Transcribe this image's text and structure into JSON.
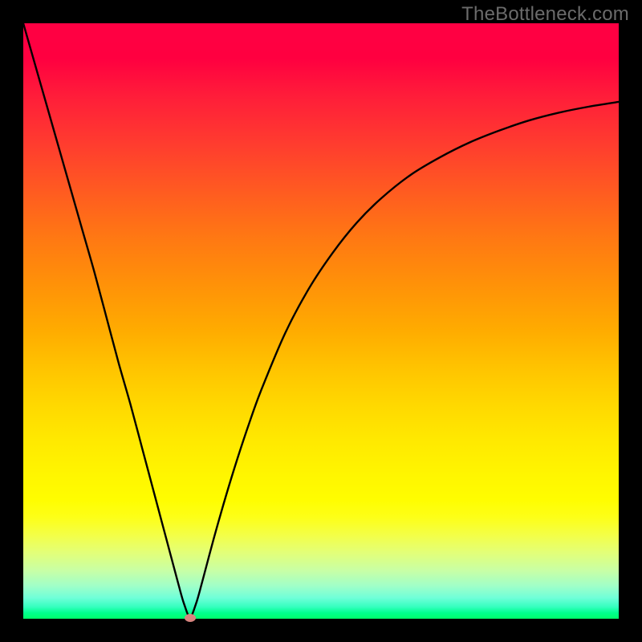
{
  "watermark": "TheBottleneck.com",
  "colors": {
    "frame": "#000000",
    "watermark_text": "#6b6b6b",
    "curve": "#000000",
    "dot": "#d8847f"
  },
  "chart_data": {
    "type": "line",
    "title": "",
    "xlabel": "",
    "ylabel": "",
    "xlim": [
      0,
      100
    ],
    "ylim": [
      0,
      100
    ],
    "grid": false,
    "legend": false,
    "series": [
      {
        "name": "bottleneck-curve",
        "x": [
          0,
          2,
          4,
          6,
          8,
          10,
          12,
          14,
          16,
          18,
          20,
          22,
          24,
          26,
          27,
          28,
          29,
          30,
          32,
          34,
          36,
          38,
          40,
          44,
          48,
          52,
          56,
          60,
          65,
          70,
          75,
          80,
          85,
          90,
          95,
          100
        ],
        "values": [
          100,
          93,
          86,
          79,
          72,
          65,
          58,
          50.5,
          43,
          36,
          28.5,
          21,
          13.5,
          6,
          2.5,
          0.3,
          2.5,
          6,
          13.5,
          20.5,
          27,
          33,
          38.5,
          48,
          55.5,
          61.5,
          66.5,
          70.5,
          74.5,
          77.5,
          80,
          82,
          83.7,
          85,
          86,
          86.8
        ]
      }
    ],
    "markers": [
      {
        "name": "optimal-point",
        "x": 28,
        "y": 0.2
      }
    ],
    "background_gradient": {
      "top": "#ff0043",
      "bottom": "#00ff6a"
    }
  }
}
